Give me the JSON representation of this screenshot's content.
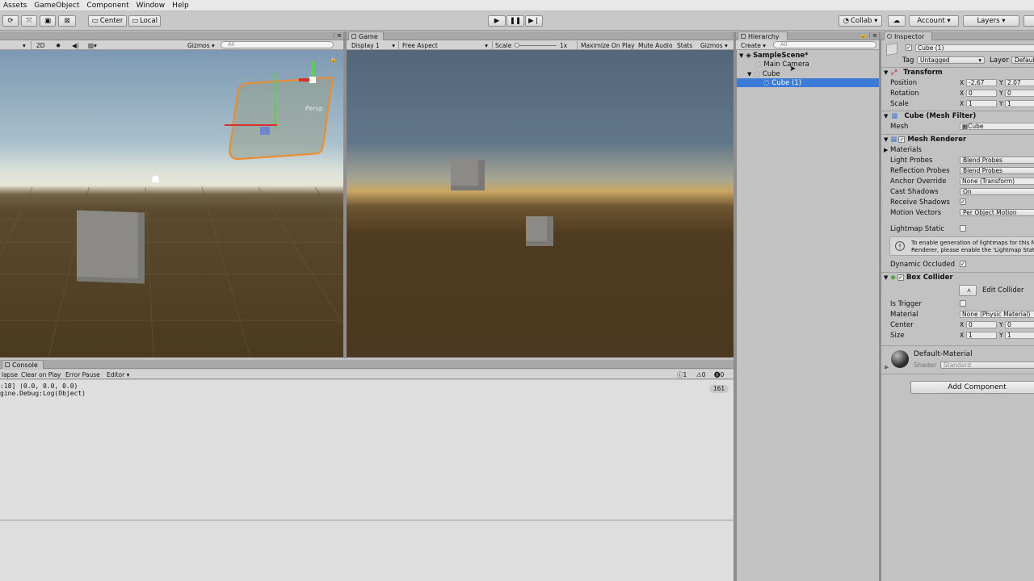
{
  "menu": [
    "Assets",
    "GameObject",
    "Component",
    "Window",
    "Help"
  ],
  "toolbar": {
    "center": "Center",
    "local": "Local",
    "collab": "Collab",
    "account": "Account",
    "layers": "Layers"
  },
  "scene": {
    "mode2d": "2D",
    "gizmos": "Gizmos",
    "search_placeholder": "All",
    "persp_label": "Persp"
  },
  "game": {
    "tab": "Game",
    "display": "Display 1",
    "aspect": "Free Aspect",
    "scale_label": "Scale",
    "scale_value": "1x",
    "maximize": "Maximize On Play",
    "mute": "Mute Audio",
    "stats": "Stats",
    "gizmos": "Gizmos"
  },
  "hierarchy": {
    "tab": "Hierarchy",
    "create": "Create",
    "search_placeholder": "All",
    "scene": "SampleScene*",
    "items": [
      "Main Camera",
      "Cube",
      "Cube (1)"
    ]
  },
  "inspector": {
    "tab": "Inspector",
    "object_name": "Cube (1)",
    "tag_label": "Tag",
    "tag_value": "Untagged",
    "layer_label": "Layer",
    "layer_value": "Default",
    "transform": {
      "title": "Transform",
      "position_label": "Position",
      "position": {
        "x": "-2.67",
        "y": "2.07"
      },
      "rotation_label": "Rotation",
      "rotation": {
        "x": "0",
        "y": "0"
      },
      "scale_label": "Scale",
      "scale": {
        "x": "1",
        "y": "1"
      }
    },
    "mesh_filter": {
      "title": "Cube (Mesh Filter)",
      "mesh_label": "Mesh",
      "mesh_value": "Cube"
    },
    "mesh_renderer": {
      "title": "Mesh Renderer",
      "materials": "Materials",
      "light_probes_label": "Light Probes",
      "light_probes": "Blend Probes",
      "reflection_label": "Reflection Probes",
      "reflection": "Blend Probes",
      "anchor_label": "Anchor Override",
      "anchor": "None (Transform)",
      "cast_label": "Cast Shadows",
      "cast": "On",
      "receive_label": "Receive Shadows",
      "motion_label": "Motion Vectors",
      "motion": "Per Object Motion",
      "lightmap_label": "Lightmap Static",
      "info_line1": "To enable generation of lightmaps for this M",
      "info_line2": "Renderer, please enable the 'Lightmap Stati",
      "occluded_label": "Dynamic Occluded"
    },
    "box_collider": {
      "title": "Box Collider",
      "edit": "Edit Collider",
      "trigger_label": "Is Trigger",
      "material_label": "Material",
      "material": "None (Physic Material)",
      "center_label": "Center",
      "center": {
        "x": "0",
        "y": "0"
      },
      "size_label": "Size",
      "size": {
        "x": "1",
        "y": "1"
      }
    },
    "material": {
      "name": "Default-Material",
      "shader_label": "Shader",
      "shader": "Standard"
    },
    "add_component": "Add Component"
  },
  "console": {
    "tab": "Console",
    "collapse": "lapse",
    "clear_on_play": "Clear on Play",
    "error_pause": "Error Pause",
    "editor": "Editor",
    "count_info": "1",
    "count_warn": "0",
    "count_err": "0",
    "line1": ":18] (0.0, 0.0, 0.0)",
    "line2": "gine.Debug:Log(Object)",
    "badge": "161"
  }
}
